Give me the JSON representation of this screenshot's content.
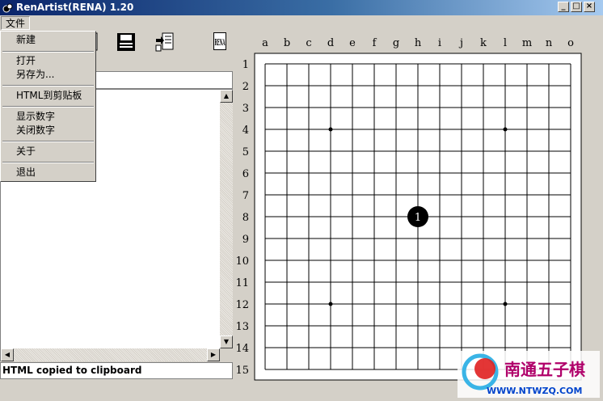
{
  "window": {
    "title": "RenArtist(RENA) 1.20",
    "buttons": {
      "minimize": "_",
      "maximize": "□",
      "close": "×"
    }
  },
  "menubar": {
    "file_label": "文件"
  },
  "file_menu": {
    "items": [
      {
        "label": "新建"
      },
      {
        "label": "打开"
      },
      {
        "label": "另存为..."
      },
      {
        "label": "HTML到剪贴板"
      },
      {
        "label": "显示数字"
      },
      {
        "label": "关闭数字"
      },
      {
        "label": "关于"
      },
      {
        "label": "退出"
      }
    ]
  },
  "toolbar": {
    "icons": [
      "save-icon",
      "export-icon",
      "rena-logo-icon"
    ],
    "logo_text": "RENA"
  },
  "status": {
    "message": "HTML copied to clipboard"
  },
  "board": {
    "size": 15,
    "col_labels": [
      "a",
      "b",
      "c",
      "d",
      "e",
      "f",
      "g",
      "h",
      "i",
      "j",
      "k",
      "l",
      "m",
      "n",
      "o"
    ],
    "row_labels": [
      "1",
      "2",
      "3",
      "4",
      "5",
      "6",
      "7",
      "8",
      "9",
      "10",
      "11",
      "12",
      "13",
      "14",
      "15"
    ],
    "star_points": [
      [
        "d",
        "4"
      ],
      [
        "l",
        "4"
      ],
      [
        "d",
        "12"
      ],
      [
        "l",
        "12"
      ]
    ],
    "stones": [
      {
        "col": "h",
        "row": "8",
        "color": "black",
        "number": "1"
      }
    ],
    "colors": {
      "grid": "#000000",
      "background": "#ffffff",
      "stone_black": "#000000",
      "stone_number": "#ffffff"
    }
  },
  "watermark": {
    "title": "南通五子棋",
    "url": "WWW.NTWZQ.COM",
    "colors": {
      "title": "#b0006a",
      "url": "#0044cc",
      "logo_ring": "#3ab4e6",
      "logo_dot": "#e02020"
    }
  }
}
